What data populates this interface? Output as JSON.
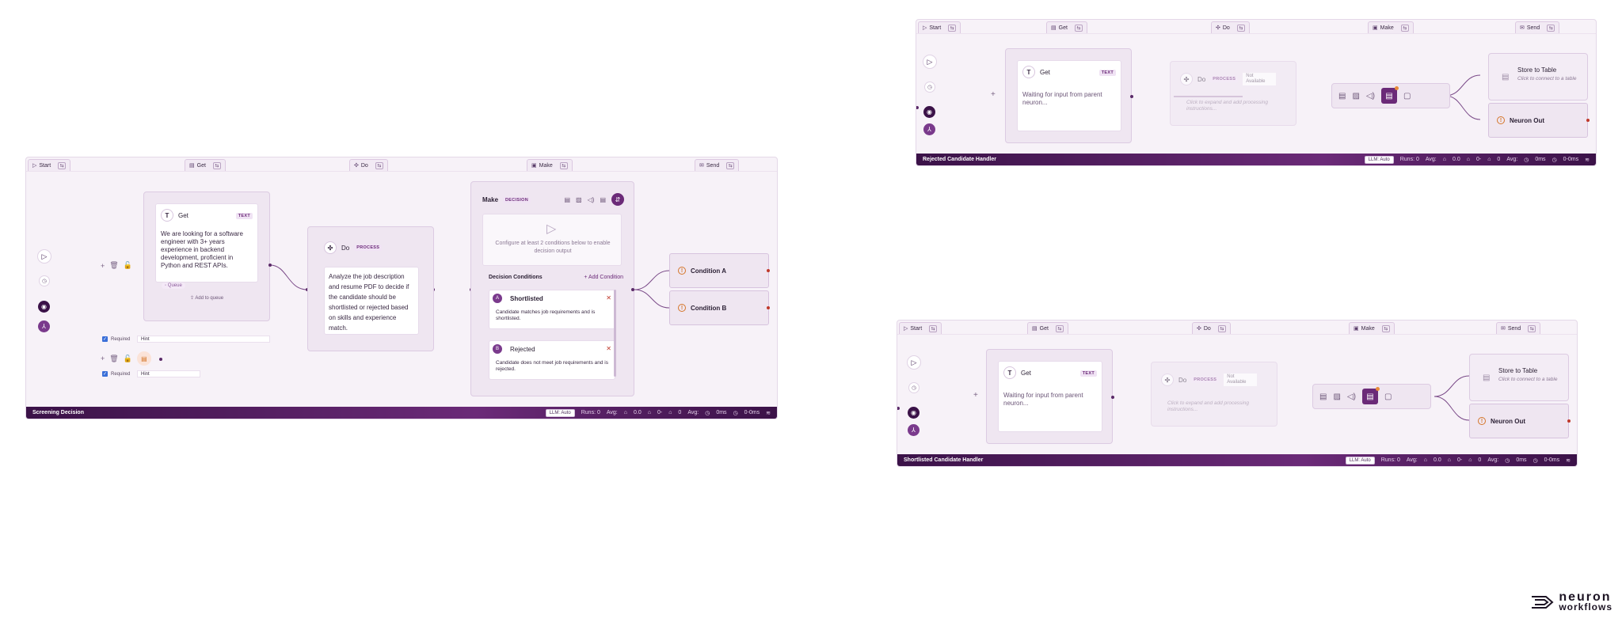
{
  "tabs": [
    "Start",
    "Get",
    "Do",
    "Make",
    "Send"
  ],
  "icons": {
    "start": "play-icon",
    "get": "document-icon",
    "do": "process-icon",
    "make": "make-icon",
    "send": "mail-icon"
  },
  "colors": {
    "accent": "#6b2a78",
    "footer": "#3b1248",
    "warning": "#d5762a",
    "danger": "#c0392b"
  },
  "panel1": {
    "footer_name": "Screening Decision",
    "llm": "LLM: Auto",
    "runs": "Runs: 0",
    "avg1": "Avg:",
    "v1": "0.0",
    "v2": "0-",
    "v3": "0",
    "avg2": "Avg:",
    "ms1": "0ms",
    "ms2": "0-0ms",
    "get": {
      "title": "Get",
      "badge": "TEXT",
      "text": "We are looking for a software engineer with 3+ years experience in backend development, proficient in Python and REST APIs.",
      "queue": "Queue",
      "add": "Add to queue"
    },
    "required": "Required",
    "hint": "Hint",
    "do": {
      "title": "Do",
      "badge": "PROCESS",
      "text": "Analyze the job description and resume PDF to decide if the candidate should be shortlisted or rejected based on skills and experience match."
    },
    "make": {
      "title": "Make",
      "badge": "DECISION",
      "placeholder": "Configure at least 2 conditions below to enable decision output",
      "conditions_title": "Decision Conditions",
      "add_condition": "+ Add Condition",
      "items": [
        {
          "letter": "A",
          "name": "Shortlisted",
          "desc": "Candidate matches job requirements and is shortlisted."
        },
        {
          "letter": "B",
          "name": "Rejected",
          "desc": "Candidate does not meet job requirements and is rejected."
        }
      ]
    },
    "conditions": [
      "Condition A",
      "Condition B"
    ]
  },
  "panel2": {
    "footer_name": "Rejected Candidate Handler",
    "llm": "LLM: Auto",
    "runs": "Runs: 0",
    "avg1": "Avg:",
    "v1": "0.0",
    "v2": "0-",
    "v3": "0",
    "avg2": "Avg:",
    "ms1": "0ms",
    "ms2": "0-0ms",
    "get": {
      "title": "Get",
      "badge": "TEXT",
      "text": "Waiting for input from parent neuron..."
    },
    "do": {
      "title": "Do",
      "badge": "PROCESS",
      "status": "Not Available",
      "text": "Click to expand and add processing instructions..."
    },
    "store": {
      "title": "Store to Table",
      "sub": "Click to connect to a table"
    },
    "neuron_out": "Neuron Out"
  },
  "panel3": {
    "footer_name": "Shortlisted Candidate Handler",
    "llm": "LLM: Auto",
    "runs": "Runs: 0",
    "avg1": "Avg:",
    "v1": "0.0",
    "v2": "0-",
    "v3": "0",
    "avg2": "Avg:",
    "ms1": "0ms",
    "ms2": "0-0ms",
    "get": {
      "title": "Get",
      "badge": "TEXT",
      "text": "Waiting for input from parent neuron..."
    },
    "do": {
      "title": "Do",
      "badge": "PROCESS",
      "status": "Not Available",
      "text": "Click to expand and add processing instructions..."
    },
    "store": {
      "title": "Store to Table",
      "sub": "Click to connect to a table"
    },
    "neuron_out": "Neuron Out"
  },
  "logo": {
    "line1": "neuron",
    "line2": "workflows"
  }
}
